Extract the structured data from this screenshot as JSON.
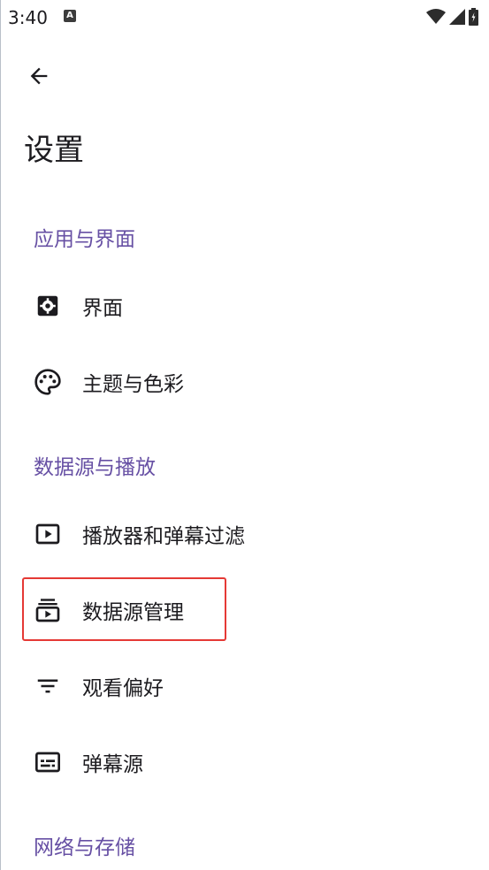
{
  "status_bar": {
    "time": "3:40",
    "notification_glyph": "A"
  },
  "header": {
    "title": "设置"
  },
  "sections": [
    {
      "title": "应用与界面",
      "items": [
        {
          "label": "界面",
          "icon": "settings-box-icon"
        },
        {
          "label": "主题与色彩",
          "icon": "palette-icon"
        }
      ]
    },
    {
      "title": "数据源与播放",
      "items": [
        {
          "label": "播放器和弹幕过滤",
          "icon": "play-box-icon"
        },
        {
          "label": "数据源管理",
          "icon": "subscriptions-icon"
        },
        {
          "label": "观看偏好",
          "icon": "filter-list-icon"
        },
        {
          "label": "弹幕源",
          "icon": "subtitles-icon"
        }
      ]
    },
    {
      "title": "网络与存储",
      "items": []
    }
  ],
  "colors": {
    "accent": "#6750a4",
    "highlight": "#e53935",
    "text": "#1c1b1f"
  }
}
